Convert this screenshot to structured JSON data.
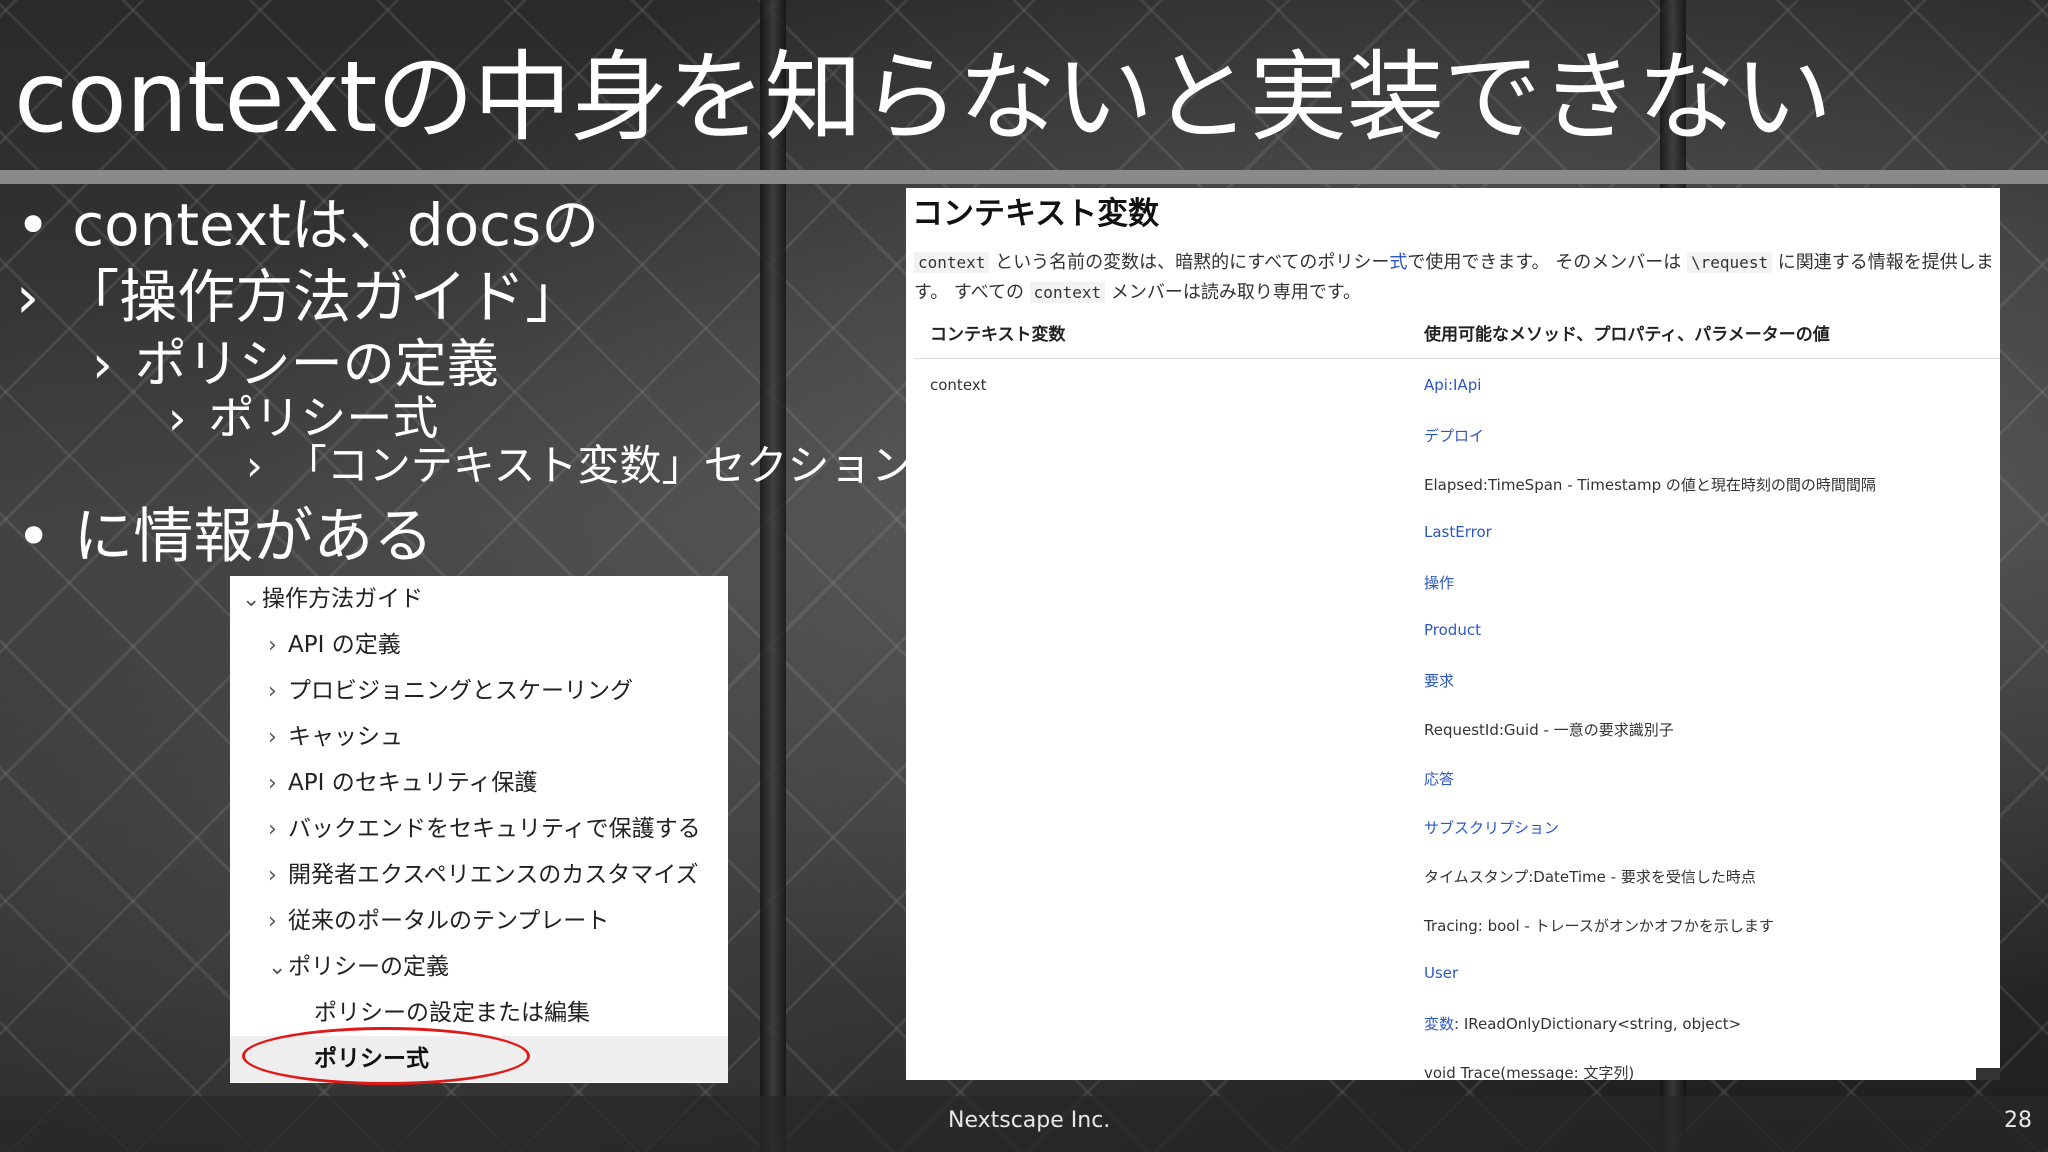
{
  "slide": {
    "title": "contextの中身を知らないと実装できない",
    "footer": "Nextscape Inc.",
    "page_number": "28"
  },
  "bullets": [
    {
      "marker": "•",
      "text": "contextは、docsの"
    },
    {
      "marker": "›",
      "text": "「操作方法ガイド」"
    },
    {
      "marker": "›",
      "text": "ポリシーの定義"
    },
    {
      "marker": "›",
      "text": "ポリシー式"
    },
    {
      "marker": "›",
      "text": "「コンテキスト変数」セクション"
    },
    {
      "marker": "•",
      "text": "に情報がある"
    }
  ],
  "nav_tree": {
    "items": [
      {
        "chev": "⌄",
        "label": "操作方法ガイド"
      },
      {
        "chev": "›",
        "label": "API の定義"
      },
      {
        "chev": "›",
        "label": "プロビジョニングとスケーリング"
      },
      {
        "chev": "›",
        "label": "キャッシュ"
      },
      {
        "chev": "›",
        "label": "API のセキュリティ保護"
      },
      {
        "chev": "›",
        "label": "バックエンドをセキュリティで保護する"
      },
      {
        "chev": "›",
        "label": "開発者エクスペリエンスのカスタマイズ"
      },
      {
        "chev": "›",
        "label": "従来のポータルのテンプレート"
      },
      {
        "chev": "⌄",
        "label": "ポリシーの定義"
      },
      {
        "chev": "",
        "label": "ポリシーの設定または編集"
      },
      {
        "chev": "",
        "label": "ポリシー式"
      }
    ],
    "active_index": 10,
    "highlight_color": "#e01818"
  },
  "doc": {
    "heading": "コンテキスト変数",
    "para1": {
      "code1": "context",
      "text1": " という名前の変数は、暗黙的にすべてのポリシー",
      "link": "式",
      "text2": "で使用できます。 そのメンバーは ",
      "code2": "\\request",
      "text3": " に関連する情報を提供しま"
    },
    "para2": {
      "text1": "す。 すべての ",
      "code": "context",
      "text2": " メンバーは読み取り専用です。"
    },
    "table": {
      "headers": [
        "コンテキスト変数",
        "使用可能なメソッド、プロパティ、パラメーターの値"
      ],
      "variable": "context",
      "members": [
        {
          "text": "Api:IApi",
          "link": true
        },
        {
          "text": "デプロイ",
          "link": true
        },
        {
          "text": "Elapsed:TimeSpan - Timestamp の値と現在時刻の間の時間間隔",
          "link": false
        },
        {
          "text": "LastError",
          "link": true
        },
        {
          "text": "操作",
          "link": true
        },
        {
          "text": "Product",
          "link": true
        },
        {
          "text": "要求",
          "link": true
        },
        {
          "text": "RequestId:Guid - 一意の要求識別子",
          "link": false
        },
        {
          "text": "応答",
          "link": true
        },
        {
          "text": "サブスクリプション",
          "link": true
        },
        {
          "text": "タイムスタンプ:DateTime - 要求を受信した時点",
          "link": false
        },
        {
          "text": "Tracing: bool - トレースがオンかオフかを示します",
          "link": false
        },
        {
          "text": "User",
          "link": true
        },
        {
          "link_part": "変数",
          "text": ": IReadOnlyDictionary<string, object>",
          "link": false,
          "mixed": true
        },
        {
          "text": "void Trace(message: 文字列)",
          "link": false
        }
      ]
    },
    "link_color": "#2b57c4"
  }
}
